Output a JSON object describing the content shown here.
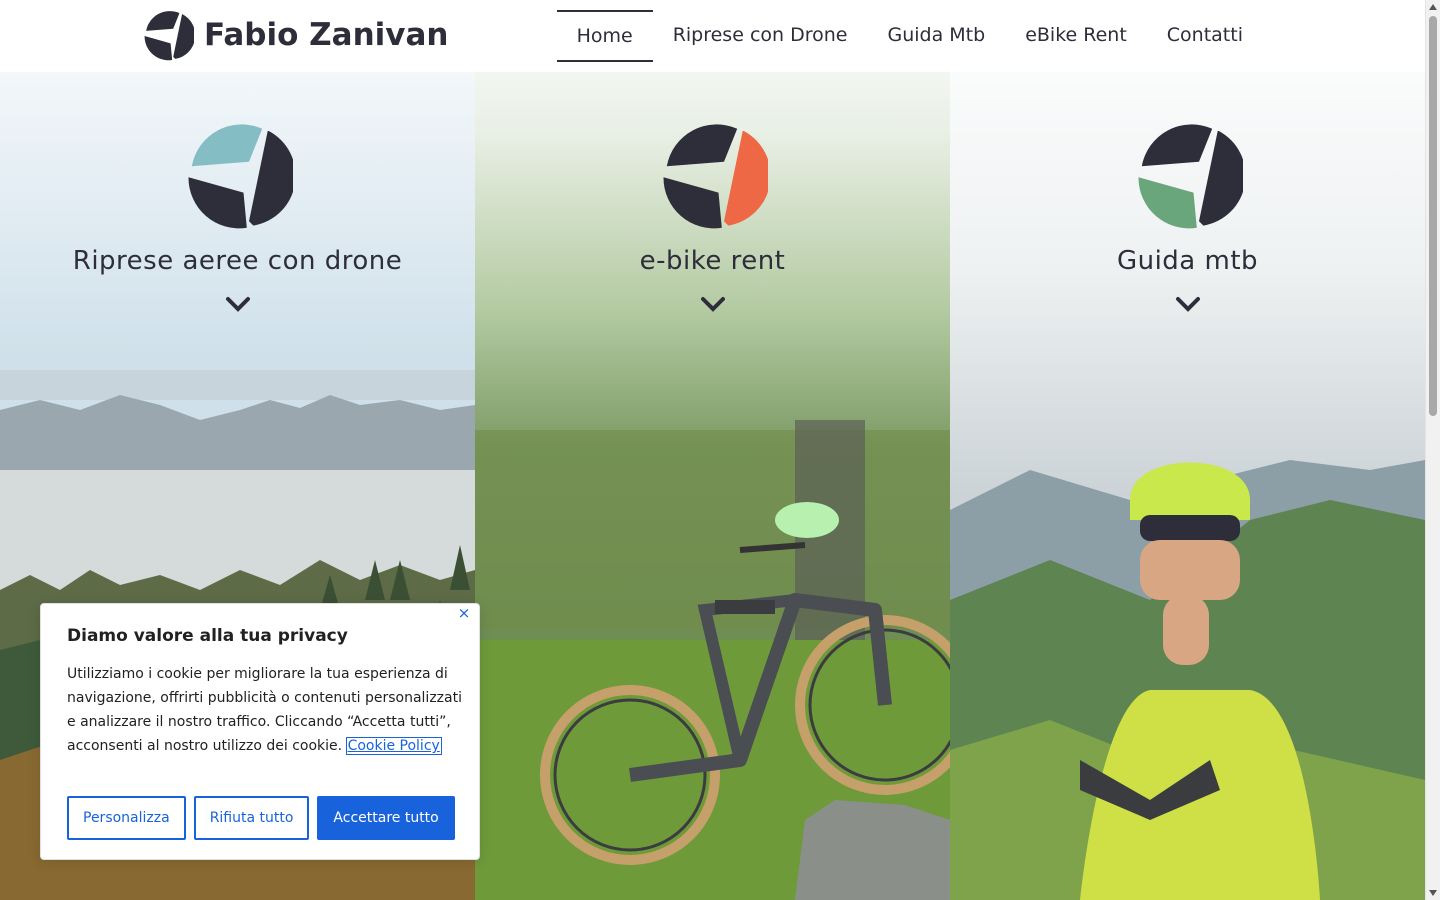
{
  "brand": {
    "name": "Fabio Zanivan"
  },
  "nav": {
    "items": [
      {
        "label": "Home",
        "active": true
      },
      {
        "label": "Riprese con Drone",
        "active": false
      },
      {
        "label": "Guida Mtb",
        "active": false
      },
      {
        "label": "eBike Rent",
        "active": false
      },
      {
        "label": "Contatti",
        "active": false
      }
    ]
  },
  "sections": [
    {
      "title": "Riprese aeree con drone",
      "accent": "#84bec4",
      "icon": "chevron-down-icon"
    },
    {
      "title": "e-bike rent",
      "accent": "#ee6845",
      "icon": "chevron-down-icon"
    },
    {
      "title": "Guida mtb",
      "accent": "#6aa67c",
      "icon": "chevron-down-icon"
    }
  ],
  "colors": {
    "dark": "#2e2e3a",
    "cookie_blue": "#1863dc"
  },
  "cookie": {
    "title": "Diamo valore alla tua privacy",
    "text": "Utilizziamo i cookie per migliorare la tua esperienza di navigazione, offrirti pubblicità o contenuti personalizzati e analizzare il nostro traffico. Cliccando “Accetta tutti”, acconsenti al nostro utilizzo dei cookie.",
    "policy_link": "Cookie Policy",
    "close": "×",
    "buttons": {
      "customize": "Personalizza",
      "reject": "Rifiuta tutto",
      "accept": "Accettare tutto"
    }
  }
}
